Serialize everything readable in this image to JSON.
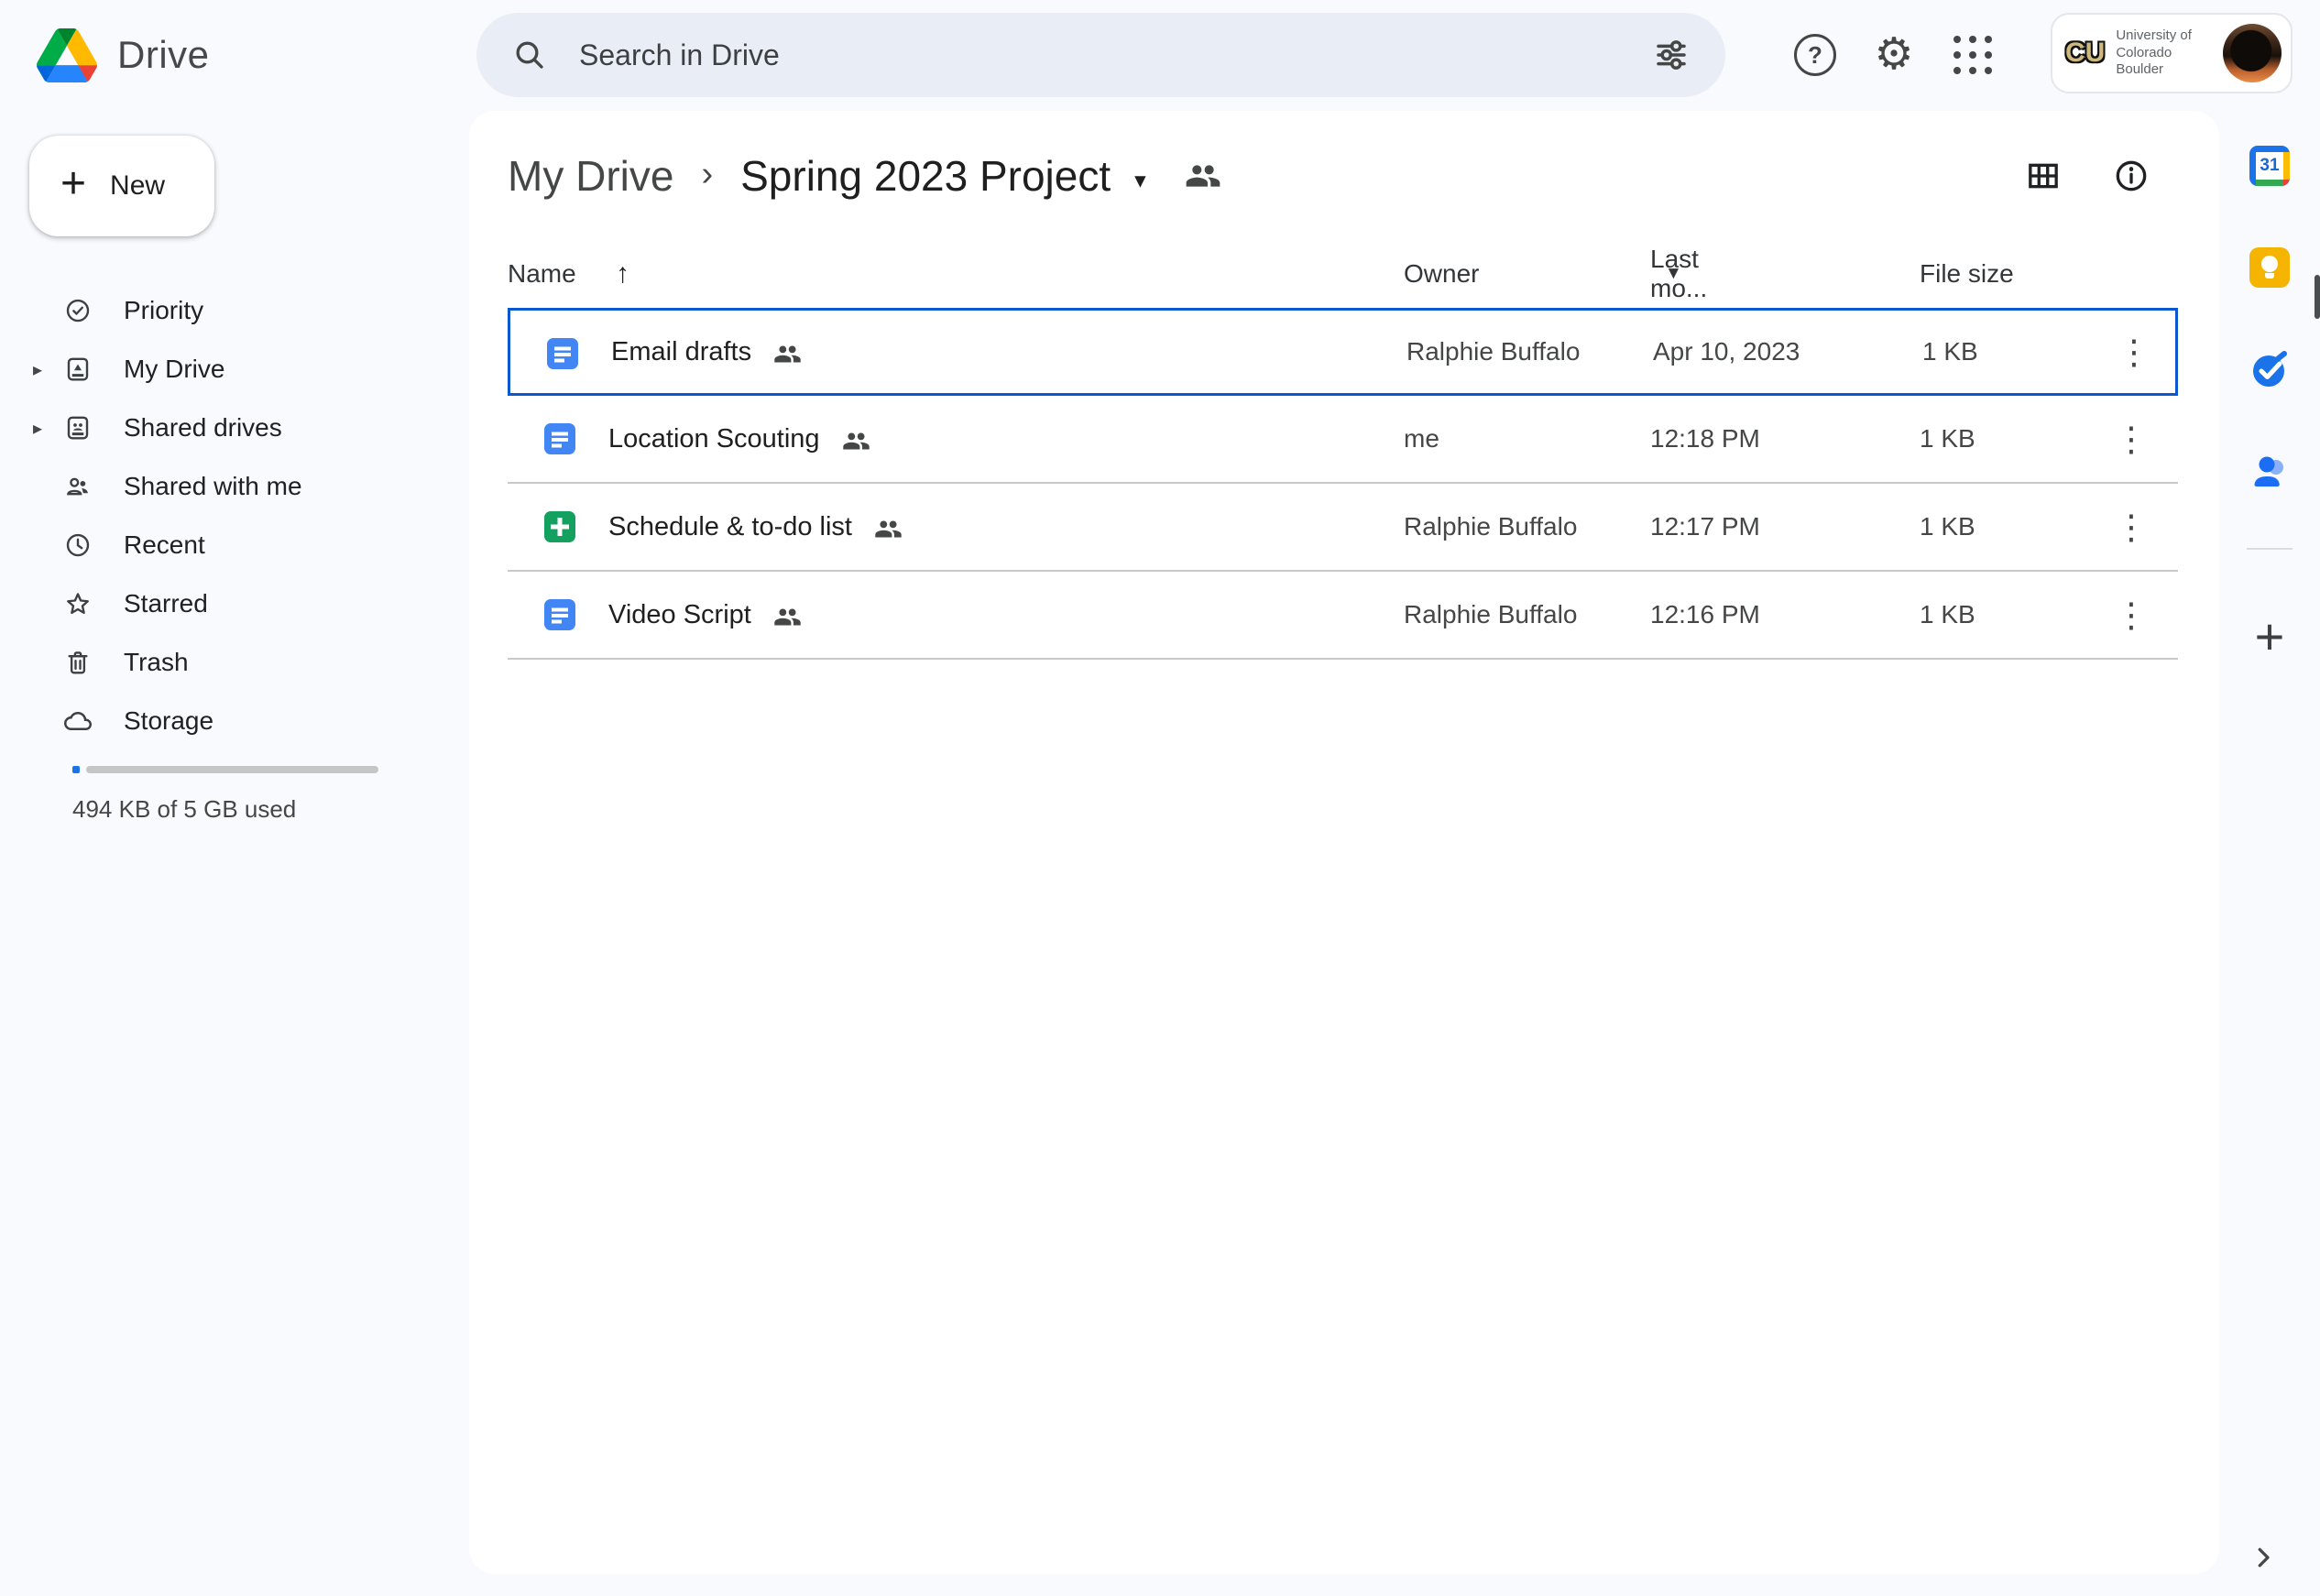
{
  "topbar": {
    "logo_text": "Drive",
    "search_placeholder": "Search in Drive",
    "account": {
      "org_logo_text": "CU",
      "org_line1": "University of Colorado",
      "org_line2": "Boulder"
    }
  },
  "sidebar": {
    "new_label": "New",
    "items": [
      {
        "label": "Priority"
      },
      {
        "label": "My Drive"
      },
      {
        "label": "Shared drives"
      },
      {
        "label": "Shared with me"
      },
      {
        "label": "Recent"
      },
      {
        "label": "Starred"
      },
      {
        "label": "Trash"
      },
      {
        "label": "Storage"
      }
    ],
    "storage_label": "494 KB of 5 GB used"
  },
  "breadcrumb": {
    "parent": "My Drive",
    "current": "Spring 2023 Project"
  },
  "table": {
    "headers": {
      "name": "Name",
      "owner": "Owner",
      "modified": "Last mo...",
      "size": "File size"
    },
    "rows": [
      {
        "name": "Email drafts",
        "owner": "Ralphie Buffalo",
        "modified": "Apr 10, 2023",
        "size": "1 KB"
      },
      {
        "name": "Location Scouting",
        "owner": "me",
        "modified": "12:18 PM",
        "size": "1 KB"
      },
      {
        "name": "Schedule & to-do list",
        "owner": "Ralphie Buffalo",
        "modified": "12:17 PM",
        "size": "1 KB"
      },
      {
        "name": "Video Script",
        "owner": "Ralphie Buffalo",
        "modified": "12:16 PM",
        "size": "1 KB"
      }
    ]
  },
  "glyphs": {
    "plus": "+",
    "side_plus": "+",
    "kebab": "⋮",
    "sort_asc": "↑",
    "caret_down": "▾",
    "header_caret": "▼",
    "breadcrumb_sep": "›",
    "expander": "▸",
    "help": "?",
    "gear": "⚙",
    "calendar_day": "31"
  },
  "colors": {
    "background": "#f8fafd",
    "search_pill": "#e9eef6",
    "selection_blue": "#0b57d0",
    "docs_blue": "#4285f4",
    "sheets_green": "#14a05f",
    "keep_yellow": "#f4b400",
    "storage_used_blue": "#1a73e8",
    "cu_gold": "#cfb87c"
  }
}
